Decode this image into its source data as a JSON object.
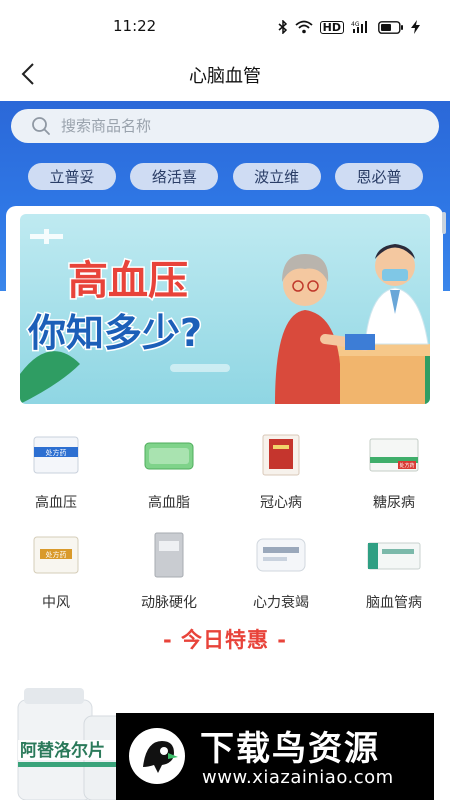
{
  "status_bar": {
    "time": "11:22",
    "icons": [
      "bluetooth-icon",
      "wifi-icon",
      "hd-icon",
      "signal-4g-icon",
      "battery-icon",
      "charging-icon"
    ],
    "hd_label": "HD",
    "network_label": "4G"
  },
  "header": {
    "title": "心脑血管",
    "back_icon": "chevron-left-icon"
  },
  "search": {
    "placeholder": "搜索商品名称",
    "icon": "search-icon"
  },
  "quick_tags": [
    {
      "label": "立普妥"
    },
    {
      "label": "络活喜"
    },
    {
      "label": "波立维"
    },
    {
      "label": "恩必普"
    }
  ],
  "banner": {
    "line1": "高血压",
    "line2": "你知多少?"
  },
  "categories": [
    {
      "label": "高血压",
      "icon": "medicine-box-icon",
      "box_text": "处方药"
    },
    {
      "label": "高血脂",
      "icon": "green-pill-box-icon",
      "box_text": ""
    },
    {
      "label": "冠心病",
      "icon": "red-medicine-box-icon",
      "box_text": ""
    },
    {
      "label": "糖尿病",
      "icon": "medicine-box-icon",
      "box_text": "处方药"
    },
    {
      "label": "中风",
      "icon": "medicine-box-icon",
      "box_text": "处方药"
    },
    {
      "label": "动脉硬化",
      "icon": "gray-medicine-box-icon",
      "box_text": ""
    },
    {
      "label": "心力衰竭",
      "icon": "white-medicine-box-icon",
      "box_text": ""
    },
    {
      "label": "脑血管病",
      "icon": "medicine-box-icon",
      "box_text": ""
    }
  ],
  "deals": {
    "title": "- 今日特惠 -",
    "product_label": "阿替洛尔片"
  },
  "watermark": {
    "title": "下载鸟资源",
    "url": "www.xiazainiao.com"
  },
  "colors": {
    "primary_blue": "#2f78e6",
    "deal_red": "#e8433a",
    "tag_bg": "#cfdcf3"
  }
}
